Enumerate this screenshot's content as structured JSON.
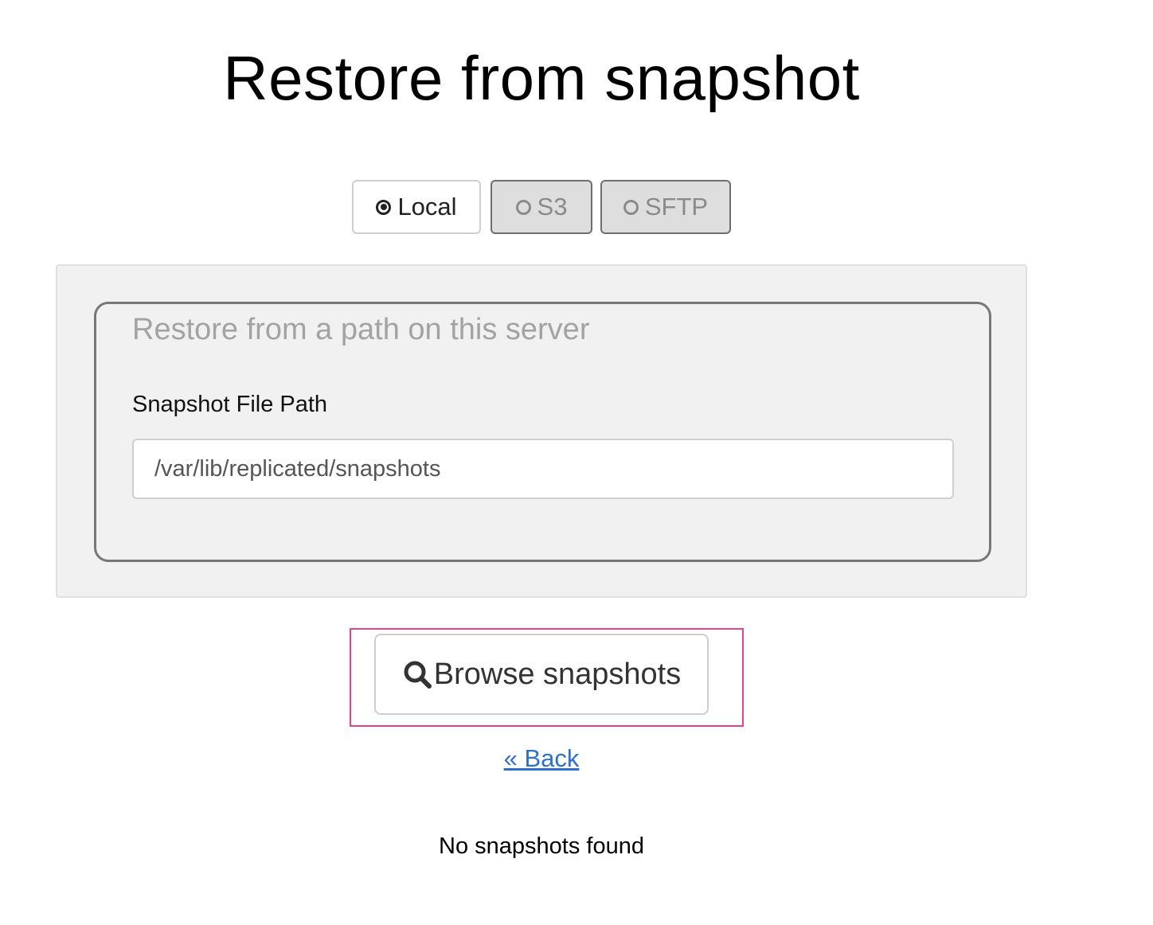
{
  "page": {
    "title": "Restore from snapshot"
  },
  "source_tabs": [
    {
      "label": "Local",
      "selected": true,
      "icon": "radio-checked-icon"
    },
    {
      "label": "S3",
      "selected": false,
      "icon": "radio-unchecked-icon"
    },
    {
      "label": "SFTP",
      "selected": false,
      "icon": "radio-unchecked-icon"
    }
  ],
  "local_panel": {
    "legend": "Restore from a path on this server",
    "path_label": "Snapshot File Path",
    "path_value": "/var/lib/replicated/snapshots"
  },
  "actions": {
    "browse_label": "Browse snapshots",
    "browse_icon": "search-icon",
    "back_label": "« Back"
  },
  "status": {
    "message": "No snapshots found"
  },
  "colors": {
    "highlight": "#e8438a",
    "link": "#2f6fd1",
    "panel_bg": "#f1f1f1",
    "inactive_tab_bg": "#dedede"
  }
}
